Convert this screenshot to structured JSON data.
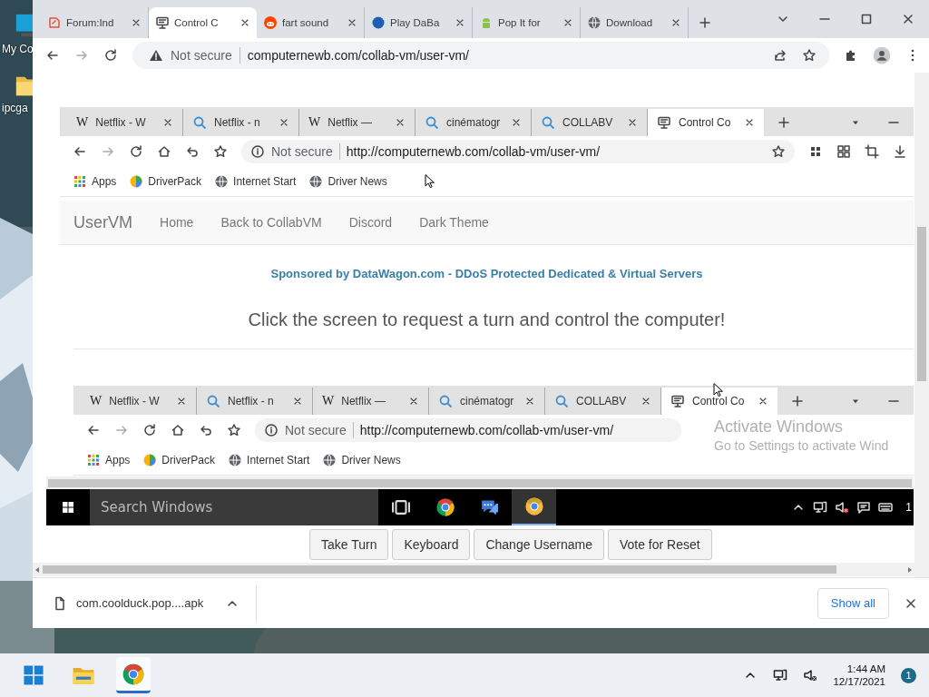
{
  "desktop": {
    "icons": [
      {
        "label": "My Co",
        "kind": "pc"
      },
      {
        "label": "ipcga",
        "kind": "folder"
      }
    ]
  },
  "browser": {
    "tabs": [
      {
        "title": "Forum:Ind",
        "kind": "forum",
        "selected": false
      },
      {
        "title": "Control C",
        "kind": "vm",
        "selected": true
      },
      {
        "title": "fart sound",
        "kind": "reddit",
        "selected": false
      },
      {
        "title": "Play DaBa",
        "kind": "dot",
        "selected": false
      },
      {
        "title": "Pop It for",
        "kind": "android",
        "selected": false
      },
      {
        "title": "Download",
        "kind": "globe",
        "selected": false
      }
    ],
    "omnibox": {
      "security": "Not secure",
      "url": "computernewb.com/collab-vm/user-vm/"
    },
    "vm": {
      "browser": {
        "tabs": [
          {
            "title": "Netflix - W",
            "kind": "wiki",
            "favicon": "W",
            "selected": false
          },
          {
            "title": "Netflix - n",
            "kind": "search",
            "selected": false
          },
          {
            "title": "Netflix —",
            "kind": "wiki",
            "favicon": "W",
            "selected": false
          },
          {
            "title": "cinématogr",
            "kind": "search",
            "selected": false
          },
          {
            "title": "COLLABV",
            "kind": "search",
            "selected": false
          },
          {
            "title": "Control Co",
            "kind": "vm",
            "selected": true
          }
        ],
        "omnibox": {
          "security": "Not secure",
          "url": "http://computernewb.com/collab-vm/user-vm/"
        },
        "bookmarks": [
          {
            "label": "Apps",
            "kind": "apps"
          },
          {
            "label": "DriverPack",
            "kind": "driverpack"
          },
          {
            "label": "Internet Start",
            "kind": "globe"
          },
          {
            "label": "Driver News",
            "kind": "globe"
          }
        ]
      },
      "page": {
        "brand": "UserVM",
        "nav": [
          "Home",
          "Back to CollabVM",
          "Discord",
          "Dark Theme"
        ],
        "sponsor": "Sponsored by DataWagon.com - DDoS Protected Dedicated & Virtual Servers",
        "prompt": "Click the screen to request a turn and control the computer!"
      },
      "nested_browser": {
        "tabs": [
          {
            "title": "Netflix - W",
            "kind": "wiki",
            "favicon": "W",
            "selected": false
          },
          {
            "title": "Netflix - n",
            "kind": "search",
            "selected": false
          },
          {
            "title": "Netflix —",
            "kind": "wiki",
            "favicon": "W",
            "selected": false
          },
          {
            "title": "cinématogr",
            "kind": "search",
            "selected": false
          },
          {
            "title": "COLLABV",
            "kind": "search",
            "selected": false
          },
          {
            "title": "Control Co",
            "kind": "vm",
            "selected": true
          }
        ],
        "omnibox": {
          "security": "Not secure",
          "url": "http://computernewb.com/collab-vm/user-vm/"
        },
        "bookmarks": [
          {
            "label": "Apps",
            "kind": "apps"
          },
          {
            "label": "DriverPack",
            "kind": "driverpack"
          },
          {
            "label": "Internet Start",
            "kind": "globe"
          },
          {
            "label": "Driver News",
            "kind": "globe"
          }
        ]
      },
      "activation": {
        "title": "Activate Windows",
        "hint": "Go to Settings to activate Wind"
      },
      "taskbar": {
        "search_placeholder": "Search Windows",
        "apps": [
          {
            "kind": "taskview",
            "selected": false
          },
          {
            "kind": "chrome",
            "selected": false
          },
          {
            "kind": "chat",
            "selected": false
          },
          {
            "kind": "canary",
            "selected": true
          }
        ],
        "clock": "1"
      }
    },
    "buttons": [
      "Take Turn",
      "Keyboard",
      "Change Username",
      "Vote for Reset"
    ],
    "download": {
      "file": "com.coolduck.pop....apk",
      "show_all": "Show all"
    }
  },
  "taskbar": {
    "apps": [
      {
        "kind": "start",
        "selected": false
      },
      {
        "kind": "explorer",
        "selected": false
      },
      {
        "kind": "chrome",
        "selected": true
      }
    ],
    "time": "1:44 AM",
    "date": "12/17/2021",
    "badge": "1"
  }
}
